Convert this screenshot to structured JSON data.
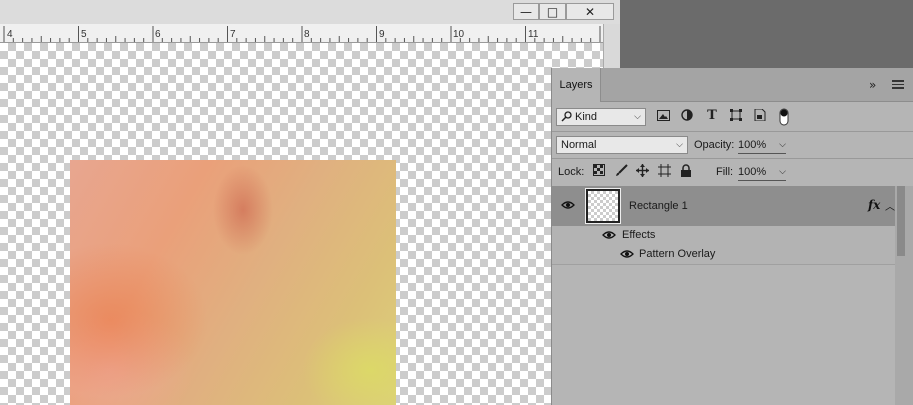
{
  "window": {
    "minimize_icon": "minimize-icon",
    "maximize_icon": "maximize-icon",
    "close_icon": "close-icon",
    "minimize_glyph": "—",
    "maximize_glyph": "□",
    "close_glyph": "✕"
  },
  "ruler": {
    "labels": [
      "4",
      "5",
      "6",
      "7",
      "8",
      "9",
      "10",
      "11"
    ]
  },
  "layers_panel": {
    "tab_label": "Layers",
    "collapse_glyph": "»",
    "filter": {
      "kind_label": "Kind",
      "search_icon": "search-icon",
      "image_filter_icon": "image-filter-icon",
      "adjustment_filter_icon": "adjustment-filter-icon",
      "type_filter_icon": "type-filter-icon",
      "shape_filter_icon": "shape-filter-icon",
      "smartobject_filter_icon": "smartobject-filter-icon",
      "filter_toggle_icon": "filter-toggle-icon",
      "type_glyph": "T"
    },
    "blend_mode": "Normal",
    "opacity_label": "Opacity:",
    "opacity_value": "100%",
    "lock_label": "Lock:",
    "fill_label": "Fill:",
    "fill_value": "100%",
    "layers": [
      {
        "name": "Rectangle 1",
        "fx_label": "fx",
        "effects_label": "Effects",
        "effects": [
          "Pattern Overlay"
        ]
      }
    ]
  },
  "colors": {
    "app_background": "#6b6b6b",
    "panel_background": "#b5b5b5",
    "selected_layer": "#8e8e8e"
  }
}
